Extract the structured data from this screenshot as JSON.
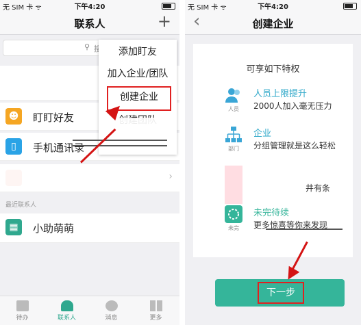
{
  "left": {
    "status": {
      "carrier": "无 SIM 卡 ᯤ",
      "time": "下午4:20"
    },
    "nav": {
      "title": "联系人",
      "add_icon": "plus-icon"
    },
    "search": {
      "placeholder": "搜"
    },
    "rows": [
      {
        "label": "盯盯好友",
        "icon": "person-icon",
        "color": "#f5a623"
      },
      {
        "label": "手机通讯录",
        "icon": "phone-icon",
        "color": "#2aa3e6"
      },
      {
        "label": "小助萌萌",
        "icon": "door-icon",
        "color": "#2fa88e"
      }
    ],
    "section": "最近联系人",
    "menu": [
      "添加盯友",
      "加入企业/团队",
      "创建企业",
      "创建团队"
    ],
    "tabs": [
      {
        "label": "待办",
        "icon": "todo-icon"
      },
      {
        "label": "联系人",
        "icon": "contacts-icon"
      },
      {
        "label": "消息",
        "icon": "message-icon"
      },
      {
        "label": "更多",
        "icon": "grid-icon"
      }
    ]
  },
  "right": {
    "status": {
      "carrier": "无 SIM 卡 ᯤ",
      "time": "下午4:20"
    },
    "nav": {
      "title": "创建企业",
      "back_icon": "back-chevron-icon"
    },
    "card": {
      "heading": "可享如下特权",
      "features": [
        {
          "title": "人员上限提升",
          "desc": "2000人加入毫无压力",
          "sub": "人员",
          "icon": "people-icon"
        },
        {
          "title": "企业",
          "desc": "分组管理就是这么轻松",
          "sub": "部门",
          "icon": "org-chart-icon"
        },
        {
          "title": "",
          "desc": "井有条",
          "sub": "",
          "icon": ""
        },
        {
          "title": "未完待续",
          "desc": "更多惊喜等你来发现",
          "sub": "未完",
          "icon": "loading-icon"
        }
      ]
    },
    "next_button": "下一步"
  }
}
